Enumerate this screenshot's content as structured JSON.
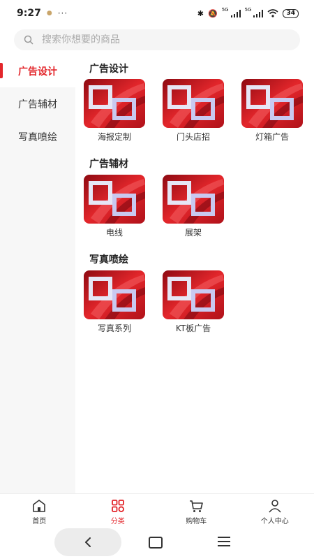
{
  "status": {
    "time": "9:27",
    "dots": "···",
    "net1": "5G",
    "net2": "5G",
    "battery": "34"
  },
  "search": {
    "placeholder": "搜索你想要的商品"
  },
  "sidebar": {
    "items": [
      {
        "label": "广告设计",
        "active": true
      },
      {
        "label": "广告辅材",
        "active": false
      },
      {
        "label": "写真喷绘",
        "active": false
      }
    ]
  },
  "sections": [
    {
      "title": "广告设计",
      "items": [
        "海报定制",
        "门头店招",
        "灯箱广告"
      ]
    },
    {
      "title": "广告辅材",
      "items": [
        "电线",
        "展架"
      ]
    },
    {
      "title": "写真喷绘",
      "items": [
        "写真系列",
        "KT板广告"
      ]
    }
  ],
  "tabs": [
    {
      "label": "首页",
      "icon": "home-icon",
      "active": false
    },
    {
      "label": "分类",
      "icon": "category-icon",
      "active": true
    },
    {
      "label": "购物车",
      "icon": "cart-icon",
      "active": false
    },
    {
      "label": "个人中心",
      "icon": "user-icon",
      "active": false
    }
  ],
  "colors": {
    "accent": "#e3262b",
    "sidebar_bg": "#f7f7f7"
  }
}
